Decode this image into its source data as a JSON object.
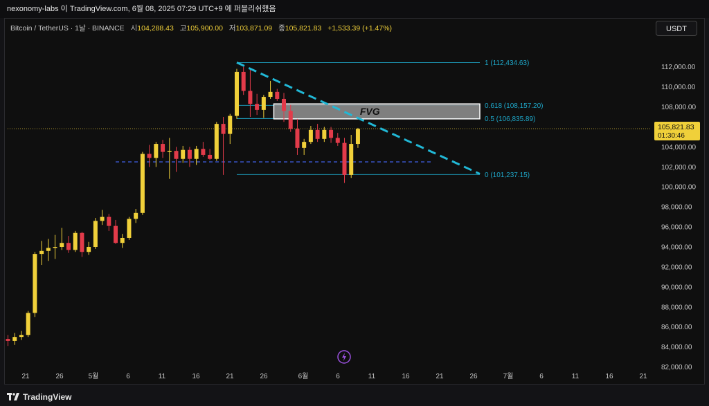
{
  "topbar": {
    "text": "nexonomy-labs 이 TradingView.com, 6월 08, 2025 07:29 UTC+9 에 퍼블리쉬했음"
  },
  "header": {
    "symbol": "Bitcoin / TetherUS · 1날 · BINANCE",
    "open_label": "시",
    "open": "104,288.43",
    "high_label": "고",
    "high": "105,900.00",
    "low_label": "저",
    "low": "103,871.09",
    "close_label": "종",
    "close": "105,821.83",
    "change": "+1,533.39 (+1.47%)",
    "currency_button": "USDT"
  },
  "footer": {
    "brand": "TradingView"
  },
  "colors": {
    "up": "#f0d03a",
    "down": "#e23b4a",
    "fib": "#1ea7c9",
    "trendline": "#21b8d6",
    "dashed_level": "#3d5bd9",
    "price_badge": "#f0d03a",
    "fvg_fill": "#8c8c8c"
  },
  "icons": [
    "lightning-icon",
    "tradingview-logo-icon"
  ],
  "chart_data": {
    "type": "candlestick",
    "title": "",
    "xlabel": "",
    "ylabel": "",
    "ylim": [
      81000,
      113500
    ],
    "x_tick_labels": [
      "21",
      "26",
      "5월",
      "6",
      "11",
      "16",
      "21",
      "26",
      "6월",
      "6",
      "11",
      "16",
      "21",
      "26",
      "7월",
      "6",
      "11",
      "16",
      "21"
    ],
    "y_tick_labels": [
      "82,000.00",
      "84,000.00",
      "86,000.00",
      "88,000.00",
      "90,000.00",
      "92,000.00",
      "94,000.00",
      "96,000.00",
      "98,000.00",
      "100,000.00",
      "102,000.00",
      "104,000.00",
      "106,000.00",
      "108,000.00",
      "110,000.00",
      "112,000.00"
    ],
    "y_ticks": [
      82000,
      84000,
      86000,
      88000,
      90000,
      92000,
      94000,
      96000,
      98000,
      100000,
      102000,
      104000,
      106000,
      108000,
      110000,
      112000
    ],
    "candles": [
      {
        "o": 84800,
        "h": 85200,
        "l": 84100,
        "c": 84600
      },
      {
        "o": 84600,
        "h": 85400,
        "l": 84200,
        "c": 85000
      },
      {
        "o": 85000,
        "h": 85600,
        "l": 84700,
        "c": 85200
      },
      {
        "o": 85200,
        "h": 87600,
        "l": 85000,
        "c": 87400
      },
      {
        "o": 87400,
        "h": 93500,
        "l": 87000,
        "c": 93300
      },
      {
        "o": 93300,
        "h": 94600,
        "l": 92200,
        "c": 93600
      },
      {
        "o": 93600,
        "h": 94800,
        "l": 92600,
        "c": 93900
      },
      {
        "o": 93900,
        "h": 95200,
        "l": 92800,
        "c": 94000
      },
      {
        "o": 94000,
        "h": 95900,
        "l": 93700,
        "c": 94400
      },
      {
        "o": 94400,
        "h": 95100,
        "l": 93400,
        "c": 93700
      },
      {
        "o": 93700,
        "h": 95600,
        "l": 93500,
        "c": 95400
      },
      {
        "o": 95400,
        "h": 95500,
        "l": 93000,
        "c": 93500
      },
      {
        "o": 93500,
        "h": 94500,
        "l": 93200,
        "c": 94000
      },
      {
        "o": 94000,
        "h": 96900,
        "l": 93800,
        "c": 96600
      },
      {
        "o": 96600,
        "h": 97700,
        "l": 96200,
        "c": 97000
      },
      {
        "o": 97000,
        "h": 97300,
        "l": 95600,
        "c": 96100
      },
      {
        "o": 96100,
        "h": 96700,
        "l": 94300,
        "c": 94400
      },
      {
        "o": 94400,
        "h": 95300,
        "l": 93900,
        "c": 94900
      },
      {
        "o": 94900,
        "h": 97000,
        "l": 94700,
        "c": 96800
      },
      {
        "o": 96800,
        "h": 97800,
        "l": 96400,
        "c": 97400
      },
      {
        "o": 97400,
        "h": 103500,
        "l": 97200,
        "c": 103300
      },
      {
        "o": 103300,
        "h": 104200,
        "l": 102000,
        "c": 102900
      },
      {
        "o": 102900,
        "h": 104500,
        "l": 102000,
        "c": 104300
      },
      {
        "o": 104300,
        "h": 104700,
        "l": 102900,
        "c": 103500
      },
      {
        "o": 103500,
        "h": 104900,
        "l": 100800,
        "c": 103600
      },
      {
        "o": 103600,
        "h": 104000,
        "l": 101500,
        "c": 102800
      },
      {
        "o": 102800,
        "h": 104100,
        "l": 102400,
        "c": 103700
      },
      {
        "o": 103700,
        "h": 104000,
        "l": 102000,
        "c": 102800
      },
      {
        "o": 102800,
        "h": 104100,
        "l": 102200,
        "c": 103800
      },
      {
        "o": 103800,
        "h": 104500,
        "l": 103000,
        "c": 103200
      },
      {
        "o": 103200,
        "h": 103800,
        "l": 102700,
        "c": 102800
      },
      {
        "o": 102800,
        "h": 106500,
        "l": 102600,
        "c": 106300
      },
      {
        "o": 106300,
        "h": 107000,
        "l": 101200,
        "c": 105300
      },
      {
        "o": 105300,
        "h": 107300,
        "l": 104300,
        "c": 107100
      },
      {
        "o": 107100,
        "h": 111800,
        "l": 106800,
        "c": 111500
      },
      {
        "o": 111500,
        "h": 112000,
        "l": 109200,
        "c": 109600
      },
      {
        "o": 109600,
        "h": 111700,
        "l": 107000,
        "c": 108300
      },
      {
        "o": 108300,
        "h": 109300,
        "l": 107200,
        "c": 107700
      },
      {
        "o": 107700,
        "h": 109200,
        "l": 106900,
        "c": 109000
      },
      {
        "o": 109000,
        "h": 110600,
        "l": 108800,
        "c": 109500
      },
      {
        "o": 109500,
        "h": 109800,
        "l": 108600,
        "c": 108800
      },
      {
        "o": 108800,
        "h": 109400,
        "l": 106500,
        "c": 107600
      },
      {
        "o": 107600,
        "h": 108200,
        "l": 105500,
        "c": 105800
      },
      {
        "o": 105800,
        "h": 106800,
        "l": 103200,
        "c": 103900
      },
      {
        "o": 103900,
        "h": 104800,
        "l": 103200,
        "c": 104500
      },
      {
        "o": 104500,
        "h": 106100,
        "l": 104300,
        "c": 105700
      },
      {
        "o": 105700,
        "h": 106300,
        "l": 104500,
        "c": 104800
      },
      {
        "o": 104800,
        "h": 106000,
        "l": 104500,
        "c": 105700
      },
      {
        "o": 105700,
        "h": 106000,
        "l": 104400,
        "c": 104900
      },
      {
        "o": 104900,
        "h": 105400,
        "l": 104100,
        "c": 104400
      },
      {
        "o": 104400,
        "h": 104900,
        "l": 100400,
        "c": 101200
      },
      {
        "o": 101200,
        "h": 105200,
        "l": 100900,
        "c": 104300
      },
      {
        "o": 104300,
        "h": 105900,
        "l": 103900,
        "c": 105800
      }
    ],
    "fibonacci": {
      "high": 112434.63,
      "low": 101237.15,
      "levels": [
        {
          "ratio": "1",
          "price": 112434.63,
          "label": "1 (112,434.63)"
        },
        {
          "ratio": "0.618",
          "price": 108157.2,
          "label": "0.618 (108,157.20)"
        },
        {
          "ratio": "0.5",
          "price": 106835.89,
          "label": "0.5 (106,835.89)"
        },
        {
          "ratio": "0",
          "price": 101237.15,
          "label": "0 (101,237.15)"
        }
      ]
    },
    "fvg": {
      "label": "FVG",
      "top": 108300,
      "bottom": 106800
    },
    "horizontal_level": 102500,
    "trendline": {
      "from_price": 112434.63,
      "to_price": 101300
    },
    "last_price": {
      "value": "105,821.83",
      "countdown": "01:30:46",
      "price": 105821.83
    }
  }
}
